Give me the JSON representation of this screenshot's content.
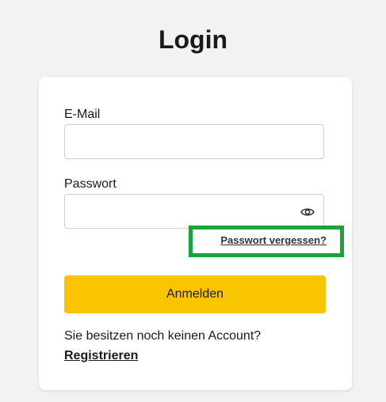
{
  "page": {
    "title": "Login"
  },
  "form": {
    "email": {
      "label": "E-Mail",
      "value": "",
      "placeholder": ""
    },
    "password": {
      "label": "Passwort",
      "value": "",
      "placeholder": "",
      "toggle_icon": "eye-icon"
    },
    "forgot_link": "Passwort vergessen?",
    "submit_label": "Anmelden"
  },
  "signup": {
    "prompt": "Sie besitzen noch keinen Account?",
    "link": "Registrieren"
  },
  "colors": {
    "accent": "#f9c400",
    "highlight": "#17a53b"
  }
}
